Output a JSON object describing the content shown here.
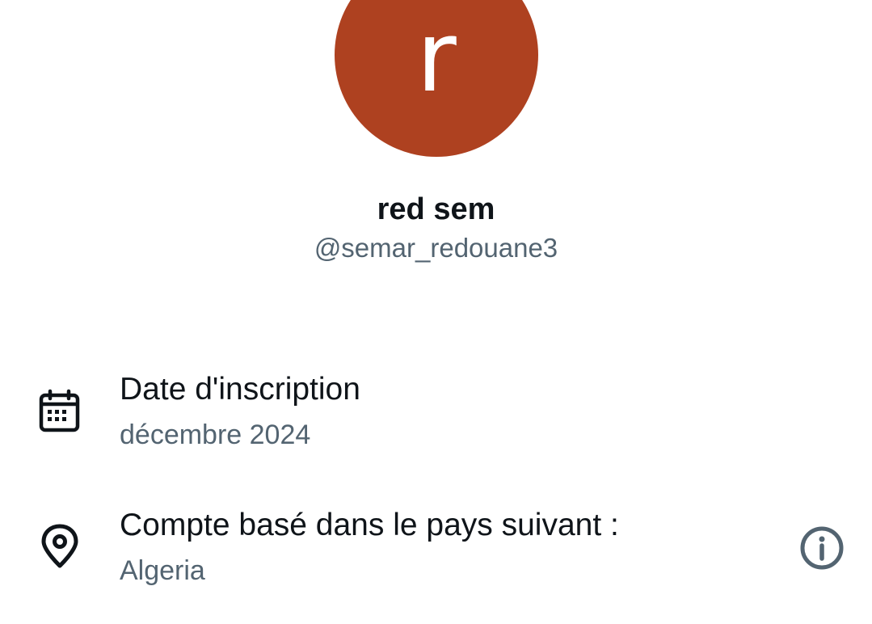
{
  "profile": {
    "avatar_letter": "r",
    "avatar_color": "#ae4120",
    "display_name": "red sem",
    "handle": "@semar_redouane3"
  },
  "details": {
    "joined": {
      "icon": "calendar-icon",
      "title": "Date d'inscription",
      "value": "décembre 2024"
    },
    "location": {
      "icon": "location-pin-icon",
      "title": "Compte basé dans le pays suivant :",
      "value": "Algeria",
      "info_icon": "info-icon"
    }
  },
  "colors": {
    "primary_text": "#0f1419",
    "secondary_text": "#536471"
  }
}
